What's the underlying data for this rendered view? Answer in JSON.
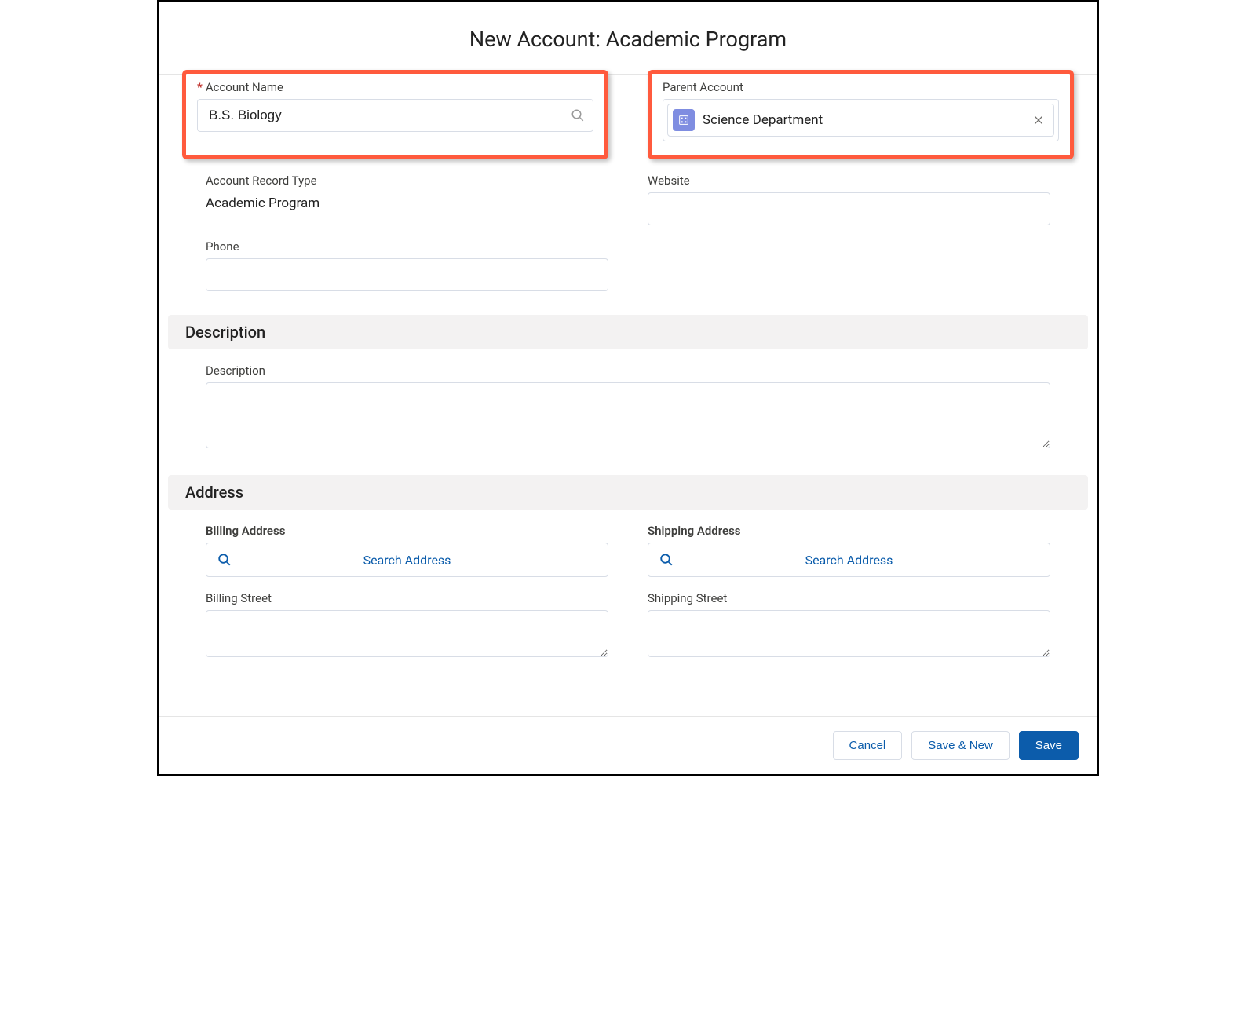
{
  "modal": {
    "title": "New Account: Academic Program"
  },
  "fields": {
    "accountName": {
      "label": "Account Name",
      "value": "B.S. Biology",
      "required": true
    },
    "parentAccount": {
      "label": "Parent Account",
      "selected": "Science Department"
    },
    "recordType": {
      "label": "Account Record Type",
      "value": "Academic Program"
    },
    "website": {
      "label": "Website",
      "value": ""
    },
    "phone": {
      "label": "Phone",
      "value": ""
    },
    "description": {
      "sectionTitle": "Description",
      "label": "Description",
      "value": ""
    },
    "address": {
      "sectionTitle": "Address",
      "billing": {
        "label": "Billing Address",
        "searchLabel": "Search Address",
        "streetLabel": "Billing Street",
        "streetValue": ""
      },
      "shipping": {
        "label": "Shipping Address",
        "searchLabel": "Search Address",
        "streetLabel": "Shipping Street",
        "streetValue": ""
      }
    }
  },
  "footer": {
    "cancel": "Cancel",
    "saveNew": "Save & New",
    "save": "Save"
  }
}
